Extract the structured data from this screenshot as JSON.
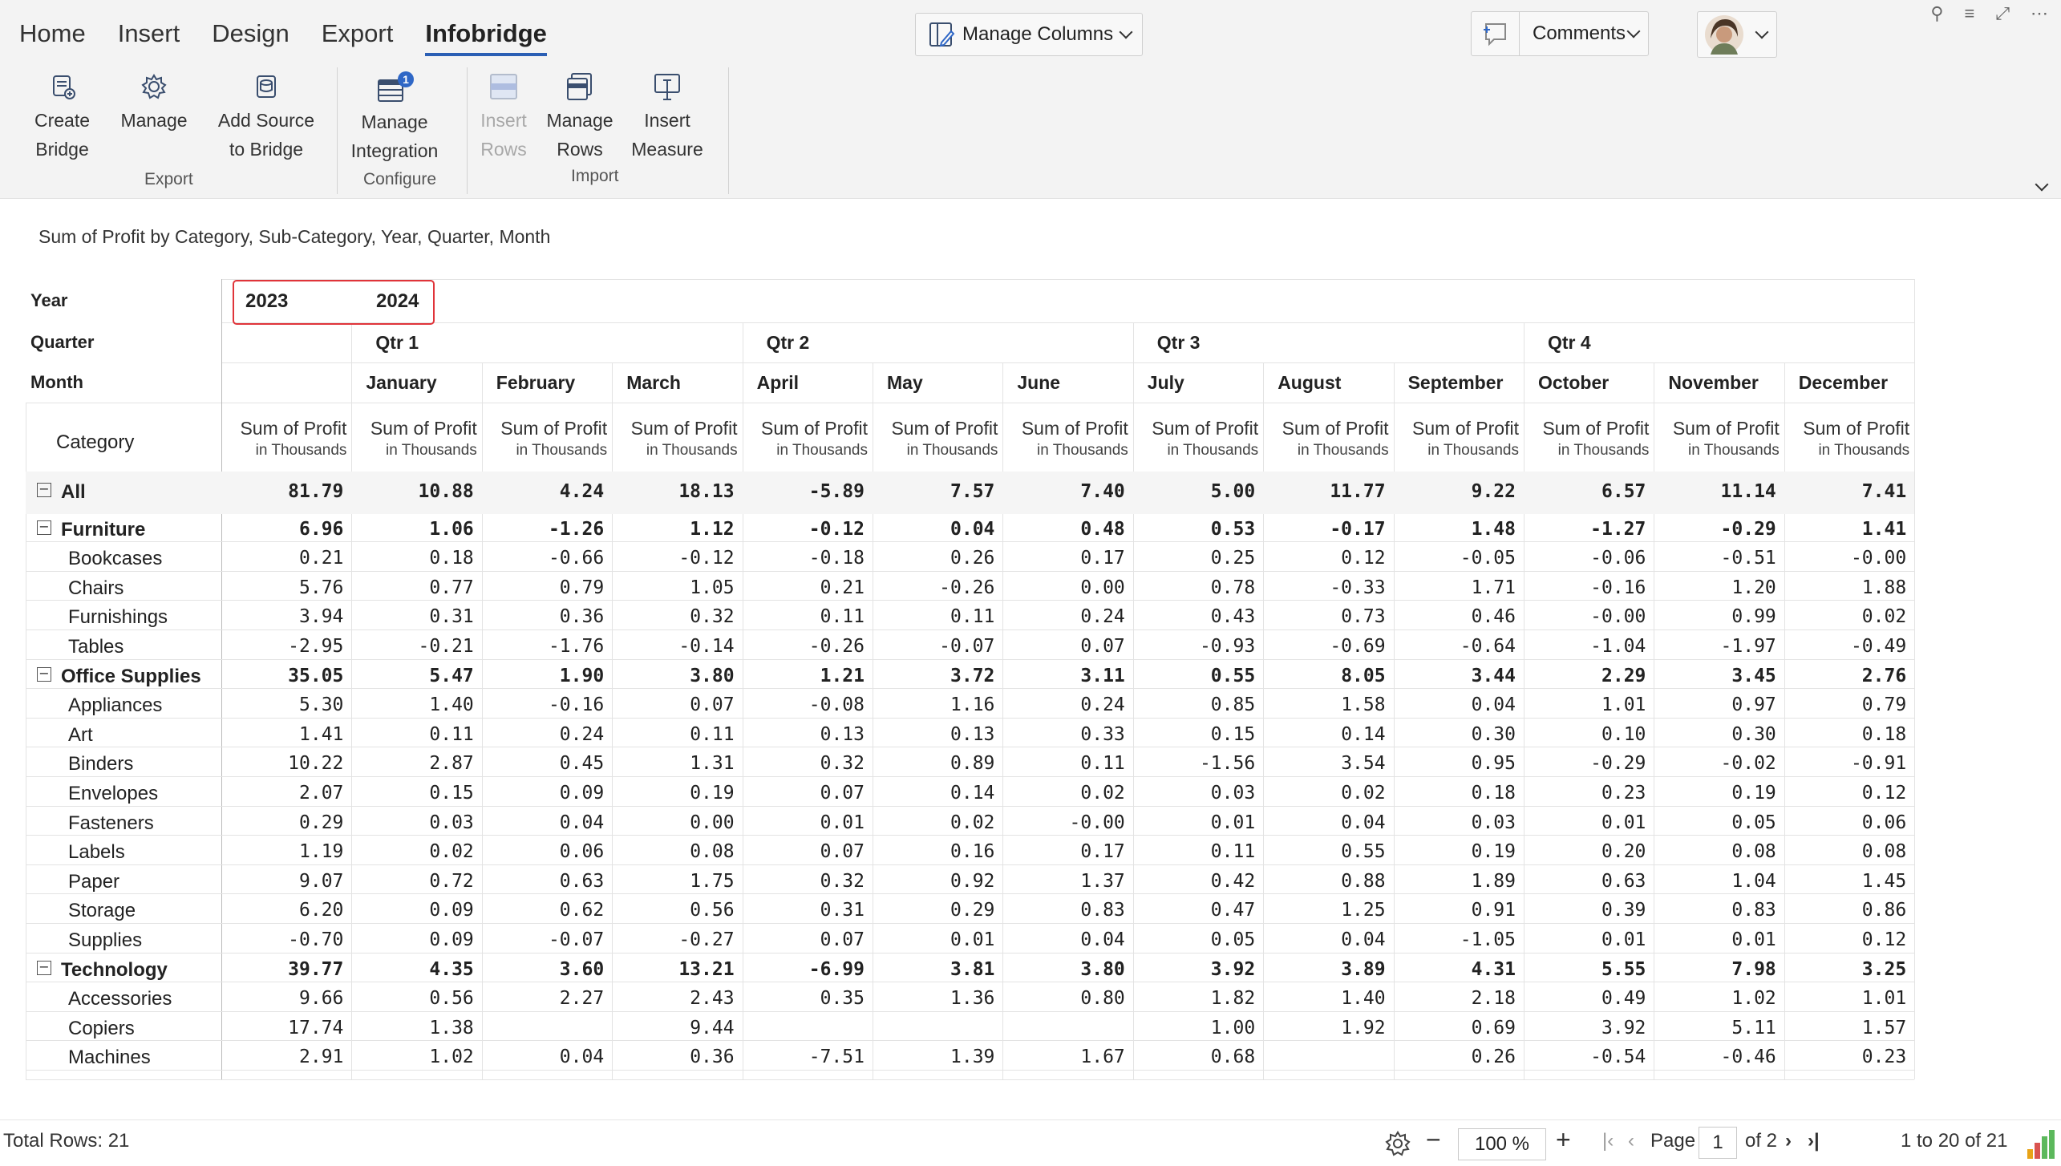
{
  "ribbon": {
    "tabs": [
      {
        "label": "Home"
      },
      {
        "label": "Insert"
      },
      {
        "label": "Design"
      },
      {
        "label": "Export"
      },
      {
        "label": "Infobridge"
      }
    ],
    "active_tab": "Infobridge",
    "buttons": {
      "create_bridge": [
        "Create",
        "Bridge"
      ],
      "manage": [
        "Manage"
      ],
      "add_source": [
        "Add Source",
        "to Bridge"
      ],
      "manage_integration": [
        "Manage",
        "Integration"
      ],
      "insert_rows": [
        "Insert",
        "Rows"
      ],
      "manage_rows": [
        "Manage",
        "Rows"
      ],
      "insert_measure": [
        "Insert",
        "Measure"
      ]
    },
    "integration_badge": "1",
    "groups": {
      "export": "Export",
      "configure": "Configure",
      "import": "Import"
    },
    "manage_columns": "Manage Columns",
    "comments": "Comments",
    "accent": "#2b5fb4"
  },
  "report": {
    "title": "Sum of Profit by Category, Sub-Category, Year, Quarter, Month",
    "header_labels": {
      "year": "Year",
      "quarter": "Quarter",
      "month": "Month",
      "category": "Category"
    },
    "years": [
      "2023",
      "2024"
    ],
    "quarters": [
      "Qtr 1",
      "Qtr 2",
      "Qtr 3",
      "Qtr 4"
    ],
    "months": [
      "January",
      "February",
      "March",
      "April",
      "May",
      "June",
      "July",
      "August",
      "September",
      "October",
      "November",
      "December"
    ],
    "measure": {
      "name": "Sum of Profit",
      "unit": "in Thousands"
    },
    "highlight_color": "#e0343a",
    "rows": [
      {
        "label": "All",
        "level": 0,
        "toggle": true,
        "total": "81.79",
        "values": [
          "10.88",
          "4.24",
          "18.13",
          "-5.89",
          "7.57",
          "7.40",
          "5.00",
          "11.77",
          "9.22",
          "6.57",
          "11.14",
          "7.41"
        ]
      },
      {
        "label": "Furniture",
        "level": 1,
        "toggle": true,
        "total": "6.96",
        "values": [
          "1.06",
          "-1.26",
          "1.12",
          "-0.12",
          "0.04",
          "0.48",
          "0.53",
          "-0.17",
          "1.48",
          "-1.27",
          "-0.29",
          "1.41"
        ]
      },
      {
        "label": "Bookcases",
        "level": 2,
        "total": "0.21",
        "values": [
          "0.18",
          "-0.66",
          "-0.12",
          "-0.18",
          "0.26",
          "0.17",
          "0.25",
          "0.12",
          "-0.05",
          "-0.06",
          "-0.51",
          "-0.00"
        ]
      },
      {
        "label": "Chairs",
        "level": 2,
        "total": "5.76",
        "values": [
          "0.77",
          "0.79",
          "1.05",
          "0.21",
          "-0.26",
          "0.00",
          "0.78",
          "-0.33",
          "1.71",
          "-0.16",
          "1.20",
          "1.88"
        ]
      },
      {
        "label": "Furnishings",
        "level": 2,
        "total": "3.94",
        "values": [
          "0.31",
          "0.36",
          "0.32",
          "0.11",
          "0.11",
          "0.24",
          "0.43",
          "0.73",
          "0.46",
          "-0.00",
          "0.99",
          "0.02"
        ]
      },
      {
        "label": "Tables",
        "level": 2,
        "total": "-2.95",
        "values": [
          "-0.21",
          "-1.76",
          "-0.14",
          "-0.26",
          "-0.07",
          "0.07",
          "-0.93",
          "-0.69",
          "-0.64",
          "-1.04",
          "-1.97",
          "-0.49"
        ]
      },
      {
        "label": "Office Supplies",
        "level": 1,
        "toggle": true,
        "total": "35.05",
        "values": [
          "5.47",
          "1.90",
          "3.80",
          "1.21",
          "3.72",
          "3.11",
          "0.55",
          "8.05",
          "3.44",
          "2.29",
          "3.45",
          "2.76"
        ]
      },
      {
        "label": "Appliances",
        "level": 2,
        "total": "5.30",
        "values": [
          "1.40",
          "-0.16",
          "0.07",
          "-0.08",
          "1.16",
          "0.24",
          "0.85",
          "1.58",
          "0.04",
          "1.01",
          "0.97",
          "0.79"
        ]
      },
      {
        "label": "Art",
        "level": 2,
        "total": "1.41",
        "values": [
          "0.11",
          "0.24",
          "0.11",
          "0.13",
          "0.13",
          "0.33",
          "0.15",
          "0.14",
          "0.30",
          "0.10",
          "0.30",
          "0.18"
        ]
      },
      {
        "label": "Binders",
        "level": 2,
        "total": "10.22",
        "values": [
          "2.87",
          "0.45",
          "1.31",
          "0.32",
          "0.89",
          "0.11",
          "-1.56",
          "3.54",
          "0.95",
          "-0.29",
          "-0.02",
          "-0.91"
        ]
      },
      {
        "label": "Envelopes",
        "level": 2,
        "total": "2.07",
        "values": [
          "0.15",
          "0.09",
          "0.19",
          "0.07",
          "0.14",
          "0.02",
          "0.03",
          "0.02",
          "0.18",
          "0.23",
          "0.19",
          "0.12"
        ]
      },
      {
        "label": "Fasteners",
        "level": 2,
        "total": "0.29",
        "values": [
          "0.03",
          "0.04",
          "0.00",
          "0.01",
          "0.02",
          "-0.00",
          "0.01",
          "0.04",
          "0.03",
          "0.01",
          "0.05",
          "0.06"
        ]
      },
      {
        "label": "Labels",
        "level": 2,
        "total": "1.19",
        "values": [
          "0.02",
          "0.06",
          "0.08",
          "0.07",
          "0.16",
          "0.17",
          "0.11",
          "0.55",
          "0.19",
          "0.20",
          "0.08",
          "0.08"
        ]
      },
      {
        "label": "Paper",
        "level": 2,
        "total": "9.07",
        "values": [
          "0.72",
          "0.63",
          "1.75",
          "0.32",
          "0.92",
          "1.37",
          "0.42",
          "0.88",
          "1.89",
          "0.63",
          "1.04",
          "1.45"
        ]
      },
      {
        "label": "Storage",
        "level": 2,
        "total": "6.20",
        "values": [
          "0.09",
          "0.62",
          "0.56",
          "0.31",
          "0.29",
          "0.83",
          "0.47",
          "1.25",
          "0.91",
          "0.39",
          "0.83",
          "0.86"
        ]
      },
      {
        "label": "Supplies",
        "level": 2,
        "total": "-0.70",
        "values": [
          "0.09",
          "-0.07",
          "-0.27",
          "0.07",
          "0.01",
          "0.04",
          "0.05",
          "0.04",
          "-1.05",
          "0.01",
          "0.01",
          "0.12"
        ]
      },
      {
        "label": "Technology",
        "level": 1,
        "toggle": true,
        "total": "39.77",
        "values": [
          "4.35",
          "3.60",
          "13.21",
          "-6.99",
          "3.81",
          "3.80",
          "3.92",
          "3.89",
          "4.31",
          "5.55",
          "7.98",
          "3.25"
        ]
      },
      {
        "label": "Accessories",
        "level": 2,
        "total": "9.66",
        "values": [
          "0.56",
          "2.27",
          "2.43",
          "0.35",
          "1.36",
          "0.80",
          "1.82",
          "1.40",
          "2.18",
          "0.49",
          "1.02",
          "1.01"
        ]
      },
      {
        "label": "Copiers",
        "level": 2,
        "total": "17.74",
        "values": [
          "1.38",
          "",
          "9.44",
          "",
          "",
          "",
          "1.00",
          "1.92",
          "0.69",
          "3.92",
          "5.11",
          "1.57"
        ]
      },
      {
        "label": "Machines",
        "level": 2,
        "total": "2.91",
        "values": [
          "1.02",
          "0.04",
          "0.36",
          "-7.51",
          "1.39",
          "1.67",
          "0.68",
          "",
          "0.26",
          "-0.54",
          "-0.46",
          "0.23"
        ]
      }
    ]
  },
  "status": {
    "total_rows": "Total Rows: 21",
    "zoom": "100 %",
    "page_label": "Page",
    "page_value": "1",
    "page_of": "of 2",
    "range": "1 to 20 of 21"
  }
}
